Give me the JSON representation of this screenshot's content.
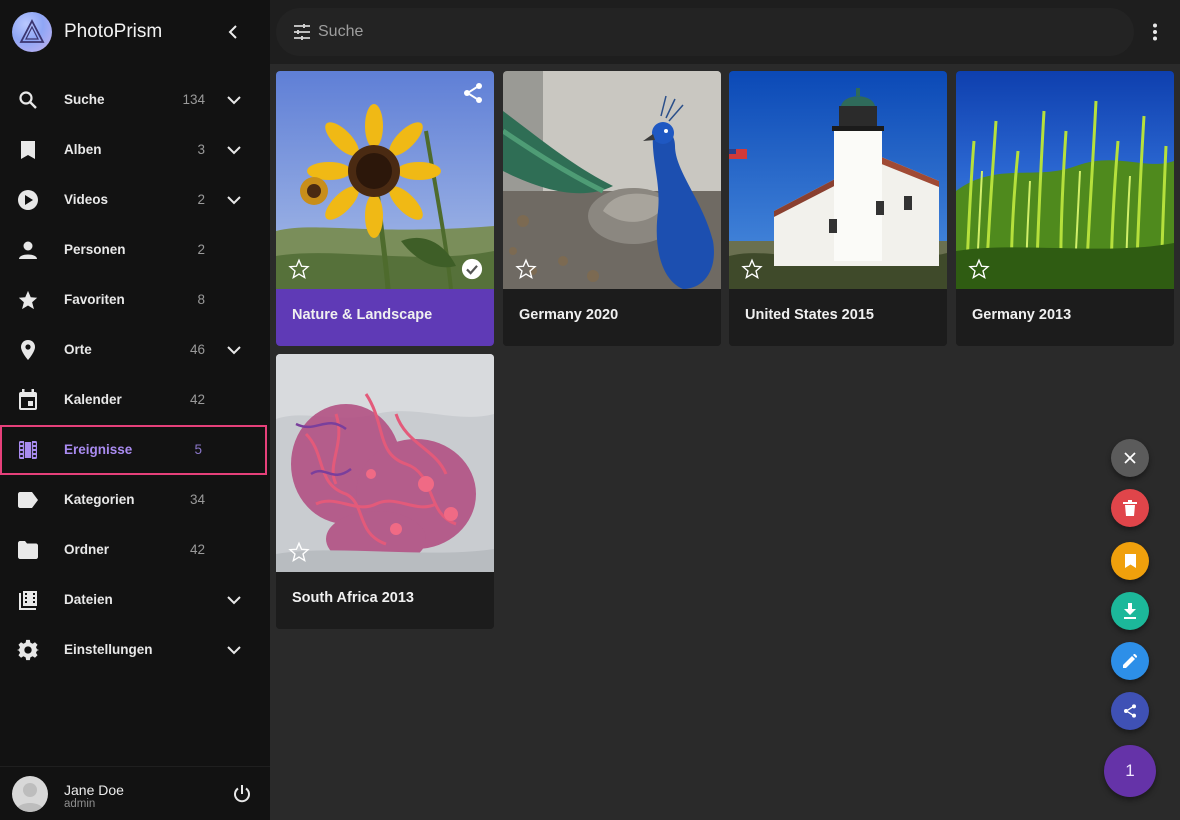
{
  "app": {
    "name": "PhotoPrism"
  },
  "search": {
    "placeholder": "Suche"
  },
  "nav": [
    {
      "label": "Suche",
      "count": "134"
    },
    {
      "label": "Alben",
      "count": "3"
    },
    {
      "label": "Videos",
      "count": "2"
    },
    {
      "label": "Personen",
      "count": "2"
    },
    {
      "label": "Favoriten",
      "count": "8"
    },
    {
      "label": "Orte",
      "count": "46"
    },
    {
      "label": "Kalender",
      "count": "42"
    },
    {
      "label": "Ereignisse",
      "count": "5"
    },
    {
      "label": "Kategorien",
      "count": "34"
    },
    {
      "label": "Ordner",
      "count": "42"
    },
    {
      "label": "Dateien",
      "count": ""
    },
    {
      "label": "Einstellungen",
      "count": ""
    }
  ],
  "user": {
    "name": "Jane Doe",
    "role": "admin"
  },
  "albums": [
    {
      "title": "Nature & Landscape",
      "selected": true
    },
    {
      "title": "Germany 2020",
      "selected": false
    },
    {
      "title": "United States 2015",
      "selected": false
    },
    {
      "title": "Germany 2013",
      "selected": false
    },
    {
      "title": "South Africa 2013",
      "selected": false
    }
  ],
  "selection": {
    "count": "1"
  },
  "colors": {
    "accent": "#5f3ab6",
    "active_outline": "#e5407a",
    "fab_close": "#5b5b5b",
    "fab_delete": "#e0454a",
    "fab_album": "#f0a00c",
    "fab_download": "#1cb89a",
    "fab_edit": "#2d8fe8",
    "fab_share": "#3f51b5"
  }
}
